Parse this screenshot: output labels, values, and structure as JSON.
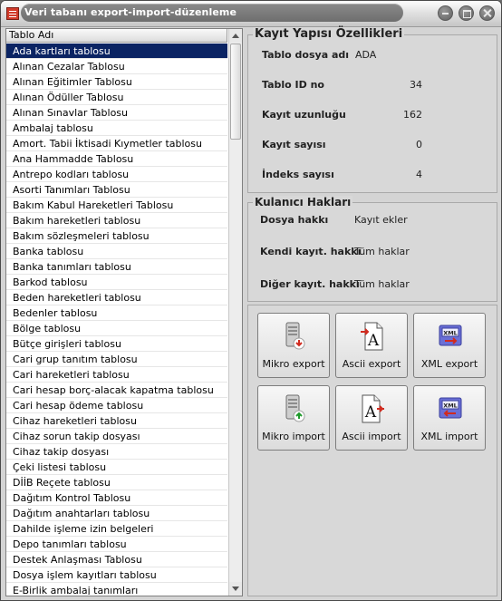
{
  "window": {
    "title": "Veri tabanı export-import-düzenleme"
  },
  "table_list": {
    "header": "Tablo Adı",
    "selected_index": 0,
    "items": [
      "Ada kartları tablosu",
      "Alınan Cezalar Tablosu",
      "Alınan Eğitimler Tablosu",
      "Alınan Ödüller Tablosu",
      "Alınan Sınavlar Tablosu",
      "Ambalaj tablosu",
      "Amort. Tabii İktisadi Kıymetler tablosu",
      "Ana Hammadde Tablosu",
      "Antrepo kodları tablosu",
      "Asorti Tanımları Tablosu",
      "Bakım Kabul Hareketleri Tablosu",
      "Bakım hareketleri tablosu",
      "Bakım sözleşmeleri tablosu",
      "Banka tablosu",
      "Banka tanımları tablosu",
      "Barkod tablosu",
      "Beden hareketleri tablosu",
      "Bedenler tablosu",
      "Bölge tablosu",
      "Bütçe girişleri tablosu",
      "Cari grup tanıtım tablosu",
      "Cari hareketleri tablosu",
      "Cari hesap borç-alacak kapatma tablosu",
      "Cari hesap ödeme tablosu",
      "Cihaz hareketleri tablosu",
      "Cihaz sorun takip dosyası",
      "Cihaz takip dosyası",
      "Çeki listesi tablosu",
      "DİİB Reçete tablosu",
      "Dağıtım Kontrol Tablosu",
      "Dağıtım anahtarları tablosu",
      "Dahilde işleme izin belgeleri",
      "Depo tanımları tablosu",
      "Destek Anlaşması Tablosu",
      "Dosya işlem kayıtları tablosu",
      "E-Birlik ambalaj tanımları"
    ]
  },
  "record_structure": {
    "title": "Kayıt Yapısı Özellikleri",
    "fields": [
      {
        "label": "Tablo dosya adı",
        "value": "ADA"
      },
      {
        "label": "Tablo ID no",
        "value": "34"
      },
      {
        "label": "Kayıt uzunluğu",
        "value": "162"
      },
      {
        "label": "Kayıt sayısı",
        "value": "0"
      },
      {
        "label": "İndeks sayısı",
        "value": "4"
      }
    ]
  },
  "user_rights": {
    "title": "Kulanıcı Hakları",
    "fields": [
      {
        "label": "Dosya hakkı",
        "value": "Kayıt ekler"
      },
      {
        "label": "Kendi kayıt. hakkı",
        "value": "Tüm haklar"
      },
      {
        "label": "Diğer kayıt. hakkı",
        "value": "Tüm haklar"
      }
    ]
  },
  "actions": {
    "mikro_export": "Mikro export",
    "ascii_export": "Ascii export",
    "xml_export": "XML export",
    "mikro_import": "Mikro import",
    "ascii_import": "Ascii import",
    "xml_import": "XML import",
    "xml_badge": "XML",
    "ascii_glyph": "A"
  },
  "icons": {
    "app": "database-export-icon",
    "minimize": "minimize-icon",
    "maximize": "maximize-icon",
    "close": "close-icon"
  }
}
